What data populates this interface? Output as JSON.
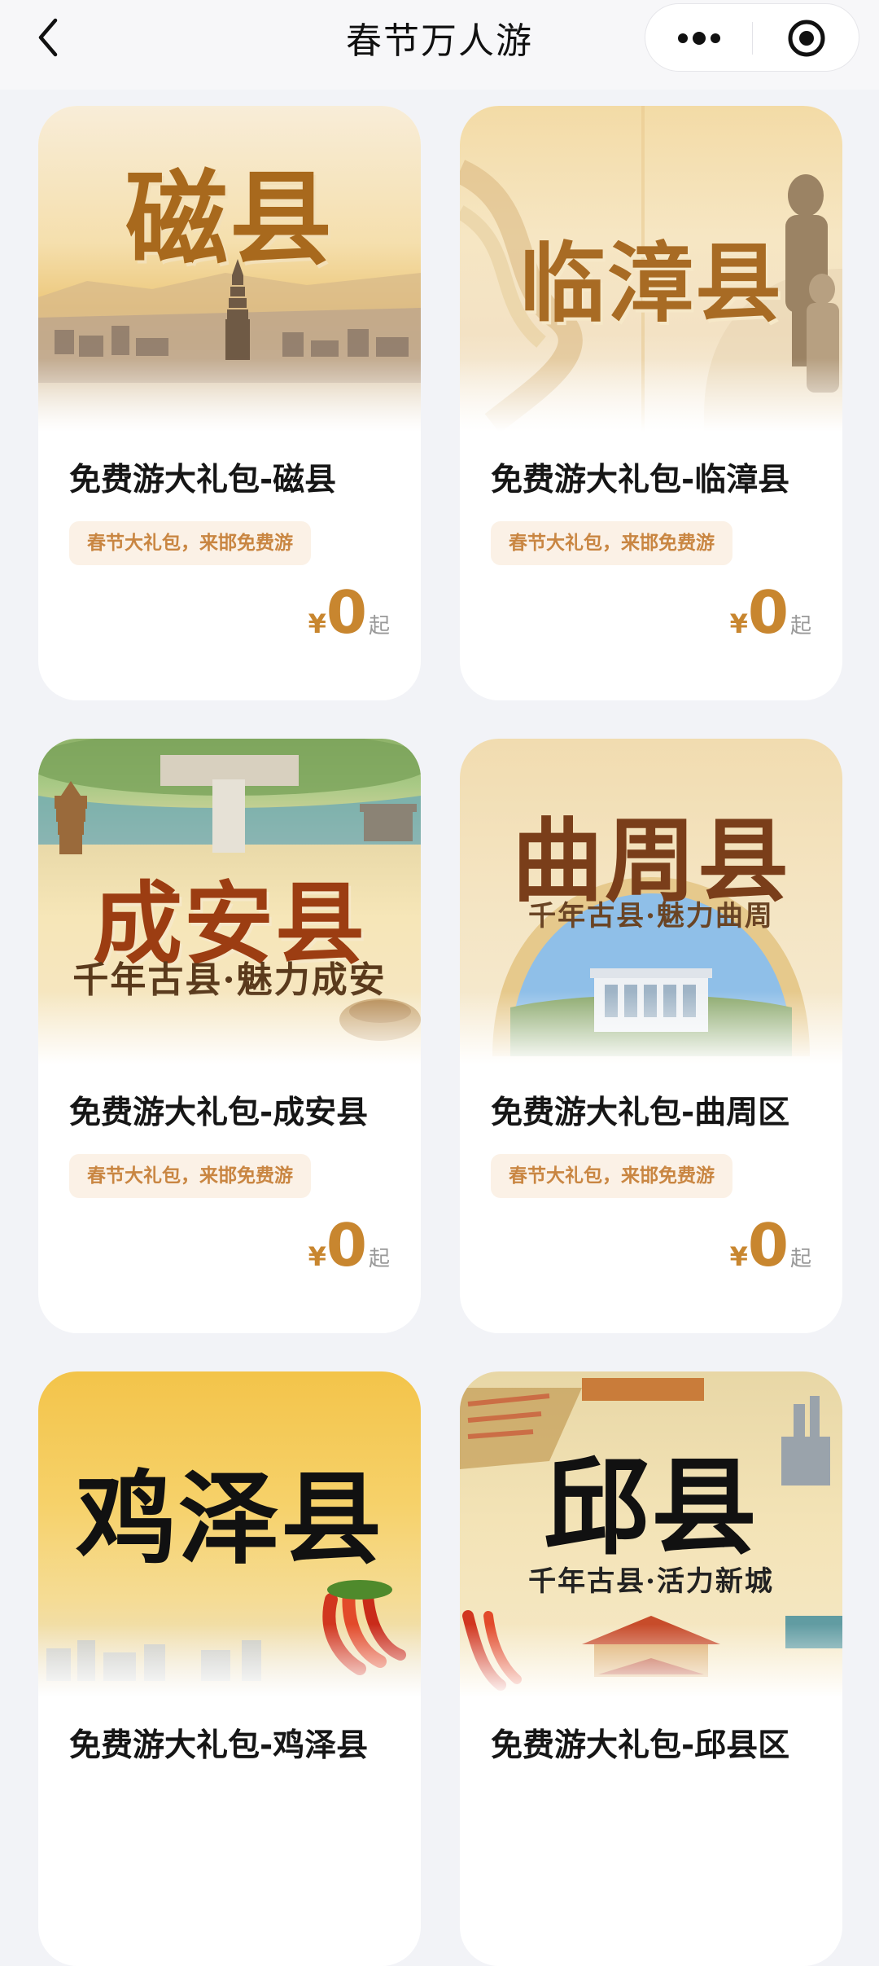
{
  "header": {
    "title": "春节万人游",
    "back_icon": "chevron-left-icon",
    "more_icon": "more-dots-icon",
    "close_icon": "target-close-icon"
  },
  "currency_symbol": "¥",
  "cards": [
    {
      "banner_name": "磁县",
      "banner_sub": "",
      "title": "免费游大礼包-磁县",
      "tag": "春节大礼包，来邯免费游",
      "price": "0",
      "price_suffix": "起"
    },
    {
      "banner_name": "临漳县",
      "banner_sub": "",
      "title": "免费游大礼包-临漳县",
      "tag": "春节大礼包，来邯免费游",
      "price": "0",
      "price_suffix": "起"
    },
    {
      "banner_name": "成安县",
      "banner_sub": "千年古县·魅力成安",
      "title": "免费游大礼包-成安县",
      "tag": "春节大礼包，来邯免费游",
      "price": "0",
      "price_suffix": "起"
    },
    {
      "banner_name": "曲周县",
      "banner_sub": "千年古县·魅力曲周",
      "title": "免费游大礼包-曲周区",
      "tag": "春节大礼包，来邯免费游",
      "price": "0",
      "price_suffix": "起"
    },
    {
      "banner_name": "鸡泽县",
      "banner_sub": "",
      "title": "免费游大礼包-鸡泽县",
      "tag": "",
      "price": "",
      "price_suffix": ""
    },
    {
      "banner_name": "邱县",
      "banner_sub": "千年古县·活力新城",
      "title": "免费游大礼包-邱县区",
      "tag": "",
      "price": "",
      "price_suffix": ""
    }
  ],
  "colors": {
    "accent_price": "#c8862f",
    "tag_bg": "#fbf1e6",
    "tag_text": "#c98642",
    "page_bg": "#f2f3f7"
  }
}
